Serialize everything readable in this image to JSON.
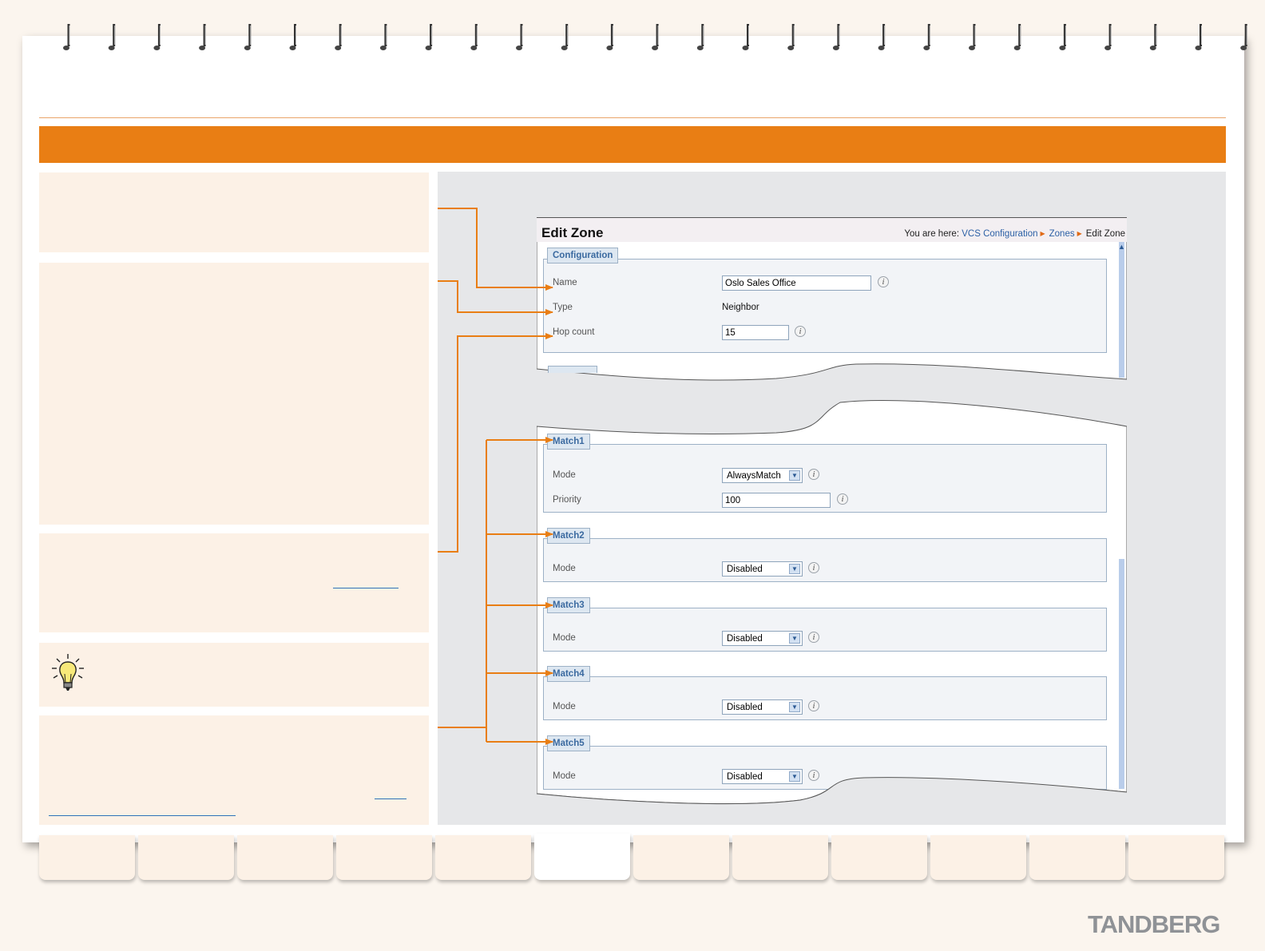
{
  "edit_zone": {
    "title": "Edit Zone",
    "breadcrumb": {
      "prefix": "You are here:",
      "items": [
        "VCS Configuration",
        "Zones",
        "Edit Zone"
      ]
    },
    "configuration": {
      "legend": "Configuration",
      "name_label": "Name",
      "name_value": "Oslo Sales Office",
      "type_label": "Type",
      "type_value": "Neighbor",
      "hop_label": "Hop count",
      "hop_value": "15"
    },
    "matches": [
      {
        "legend": "Match1",
        "mode_label": "Mode",
        "mode_value": "AlwaysMatch",
        "priority_label": "Priority",
        "priority_value": "100"
      },
      {
        "legend": "Match2",
        "mode_label": "Mode",
        "mode_value": "Disabled"
      },
      {
        "legend": "Match3",
        "mode_label": "Mode",
        "mode_value": "Disabled"
      },
      {
        "legend": "Match4",
        "mode_label": "Mode",
        "mode_value": "Disabled"
      },
      {
        "legend": "Match5",
        "mode_label": "Mode",
        "mode_value": "Disabled"
      }
    ]
  },
  "brand": "TANDBERG",
  "colors": {
    "accent": "#e97e14",
    "panel": "#fcf1e6",
    "legend_text": "#3b6aa0",
    "link": "#2d61a6"
  }
}
